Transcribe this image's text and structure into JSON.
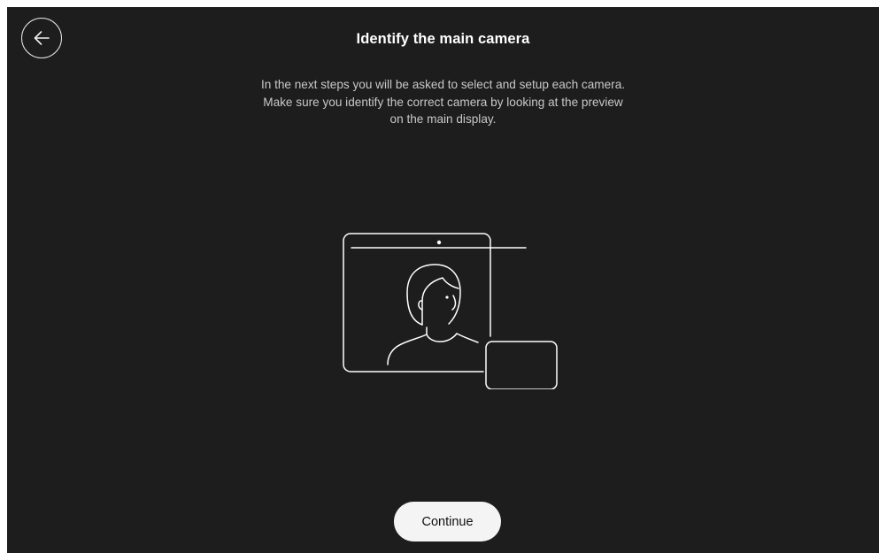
{
  "header": {
    "back_icon": "arrow-left-icon",
    "title": "Identify the main camera"
  },
  "main": {
    "description_lines": [
      "In the next steps you will be asked to select and setup each camera.",
      "Make sure you identify the correct camera by looking at the preview",
      "on the main display."
    ],
    "illustration_icon": "display-with-camera-person-illustration"
  },
  "footer": {
    "continue_label": "Continue"
  },
  "colors": {
    "background": "#1d1d1d",
    "foreground": "#ffffff",
    "secondary_text": "#c8c8c8",
    "button_background": "#f4f4f4"
  }
}
